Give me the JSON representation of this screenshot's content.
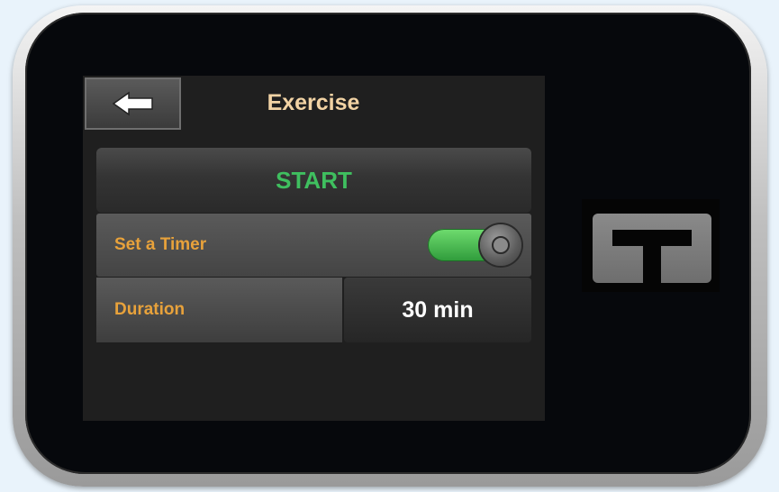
{
  "screen": {
    "title": "Exercise",
    "back_icon": "back-arrow-icon"
  },
  "start_button": {
    "label": "START",
    "color": "#3fbf5f"
  },
  "timer_row": {
    "label": "Set a Timer",
    "toggle_on": true
  },
  "duration_row": {
    "label": "Duration",
    "value": "30 min"
  },
  "hardware": {
    "t_button_icon": "t-logo-icon"
  },
  "colors": {
    "title": "#f2d3a4",
    "row_label": "#e8a23b",
    "toggle_on": "#4cc552"
  }
}
